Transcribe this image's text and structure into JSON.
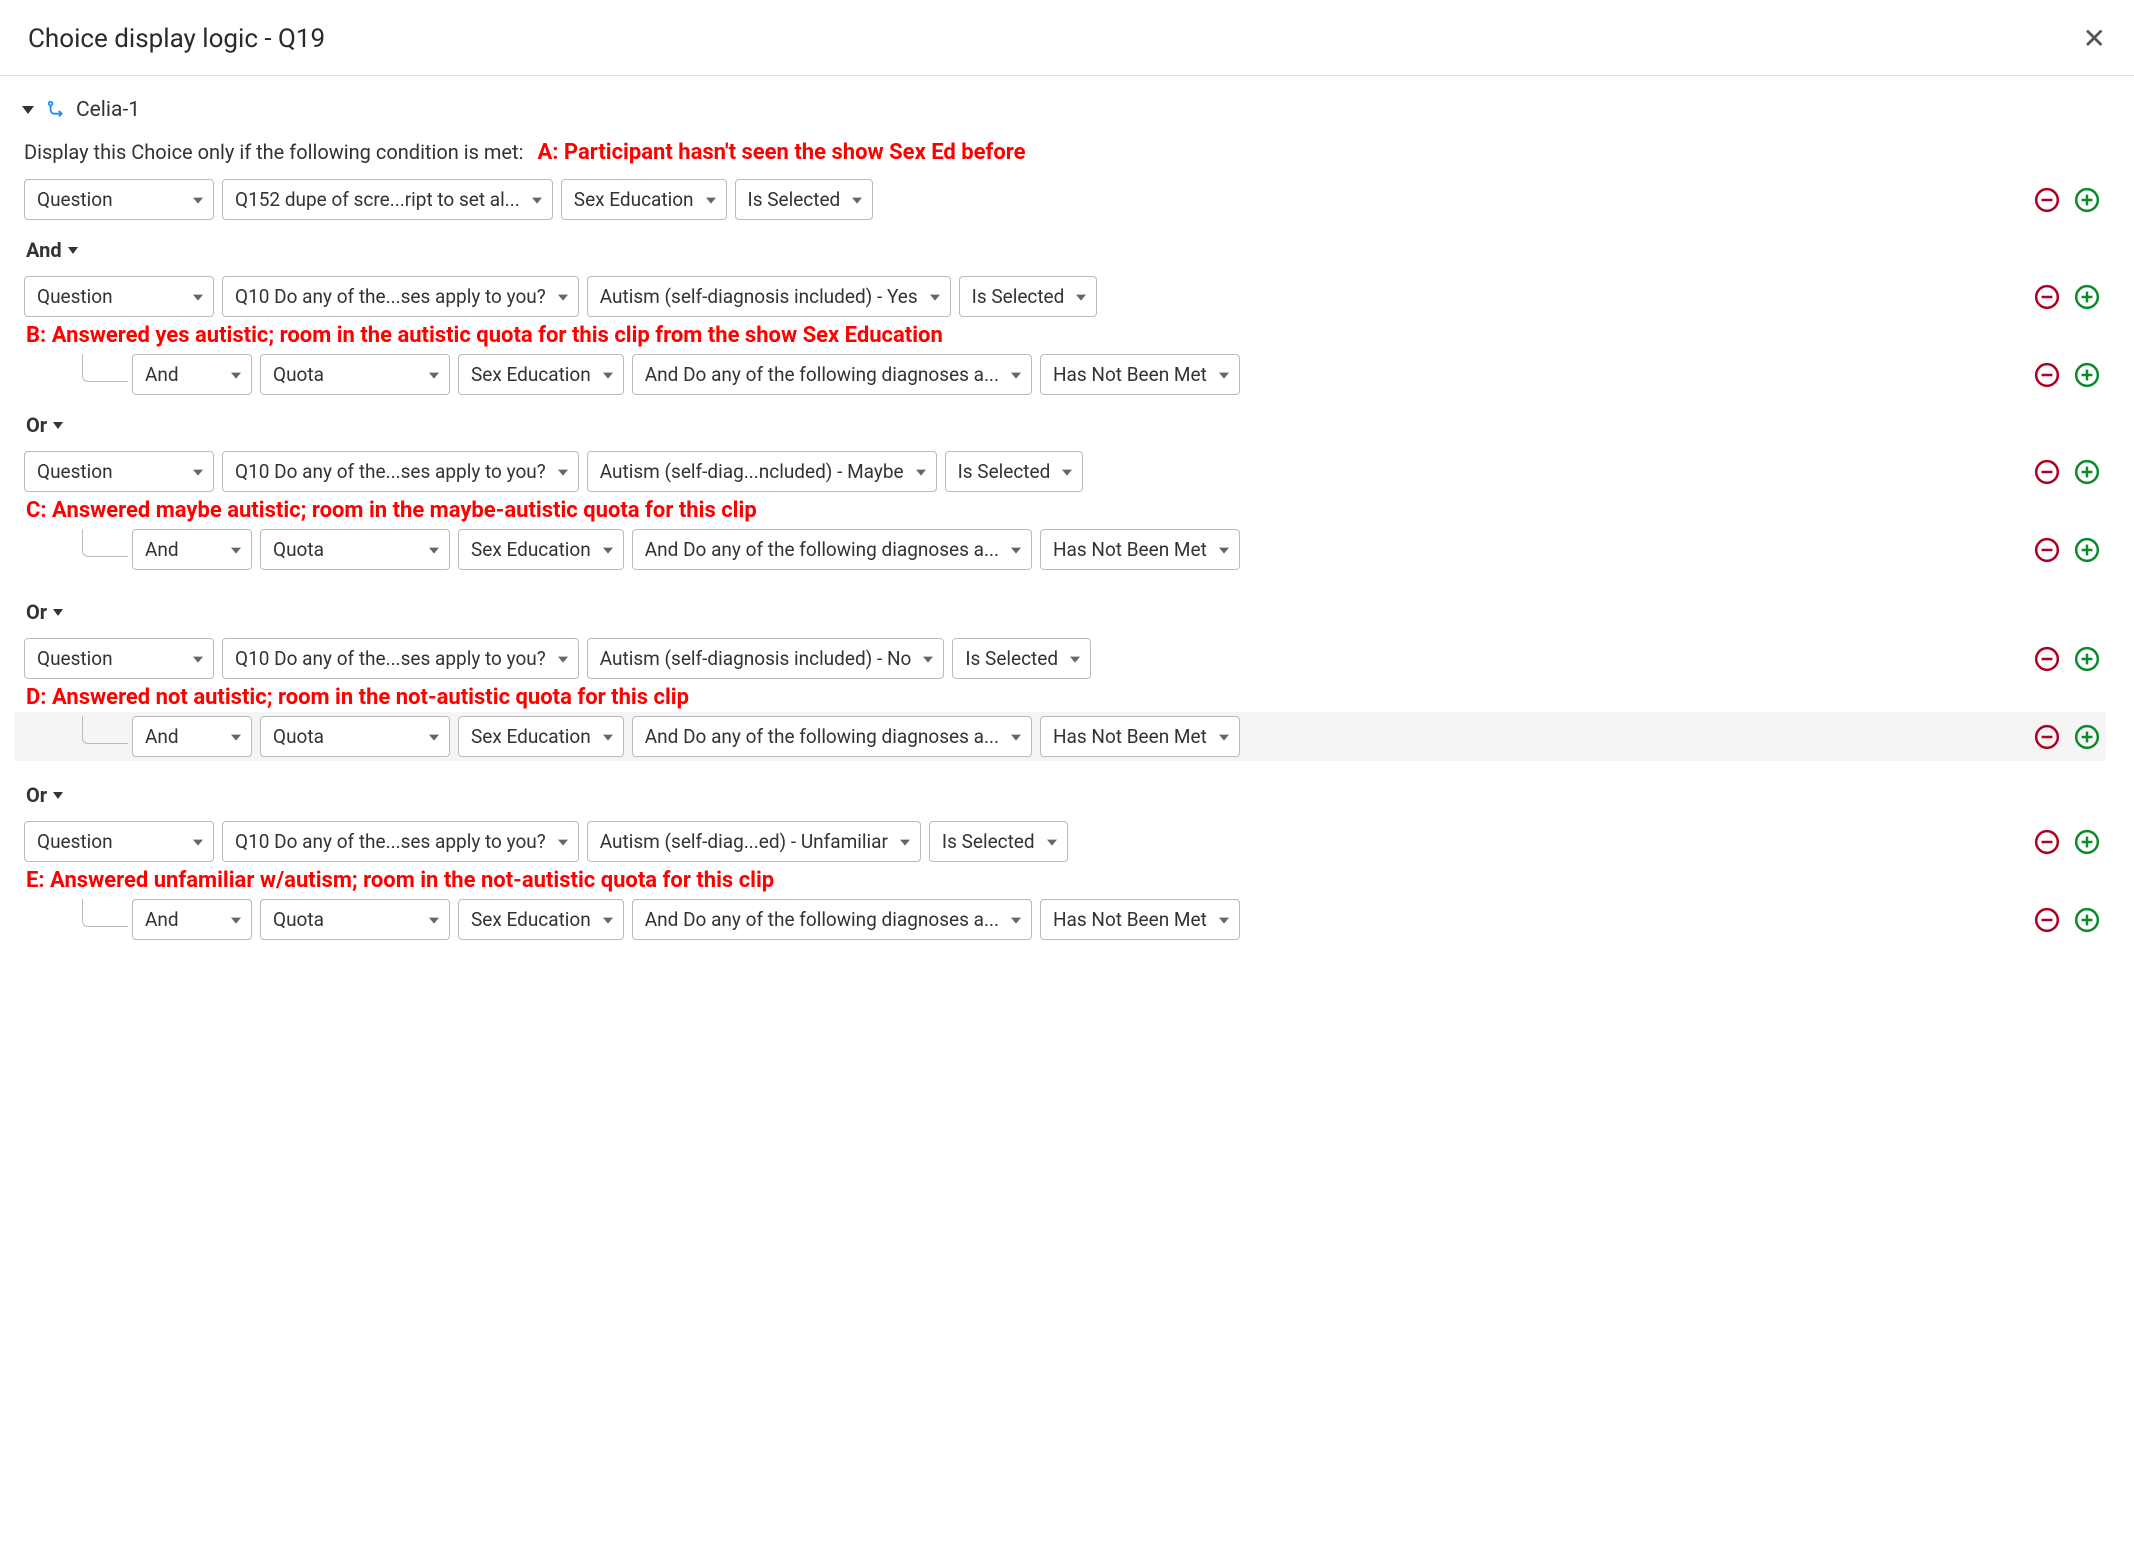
{
  "header": {
    "title": "Choice display logic - Q19"
  },
  "group": {
    "name": "Celia-1"
  },
  "prompt": "Display this Choice only if the following condition is met:",
  "annotations": {
    "a": "A: Participant hasn't seen the show Sex Ed before",
    "b": "B: Answered yes autistic; room in the autistic quota for this clip from the show Sex Education",
    "c": "C: Answered maybe autistic; room in the maybe-autistic quota for this clip",
    "d": "D: Answered not autistic; room in the not-autistic quota for this clip",
    "e": "E: Answered unfamiliar w/autism; room in the not-autistic quota for this clip"
  },
  "conn": {
    "and": "And",
    "or": "Or"
  },
  "labels": {
    "question": "Question",
    "quota": "Quota",
    "sexEd": "Sex Education",
    "isSelected": "Is Selected",
    "hasNotBeenMet": "Has Not Been Met",
    "q152": "Q152 dupe of scre...ript to set al...",
    "q10": "Q10 Do any of the...ses apply to you?",
    "quotaCond": "And Do any of the following diagnoses a...",
    "autYes": "Autism (self-diagnosis included) - Yes",
    "autMaybe": "Autism (self-diag...ncluded) - Maybe",
    "autNo": "Autism (self-diagnosis included) - No",
    "autUnfamiliar": "Autism (self-diag...ed) - Unfamiliar"
  }
}
